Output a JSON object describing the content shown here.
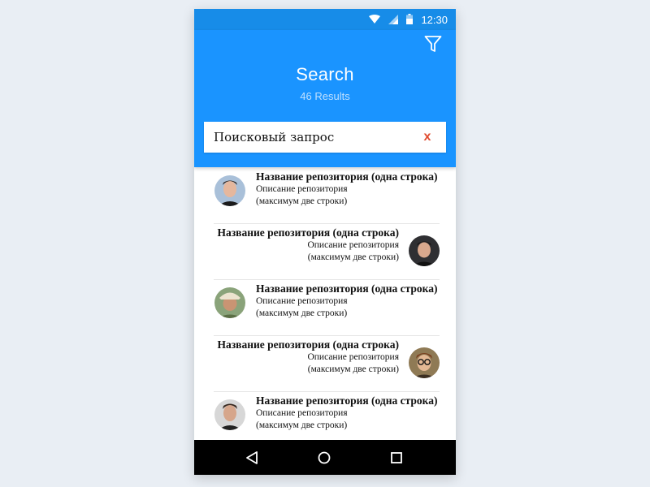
{
  "status_bar": {
    "time": "12:30",
    "icons": [
      "wifi-icon",
      "signal-icon",
      "battery-icon"
    ]
  },
  "header": {
    "title": "Search",
    "subtitle": "46 Results",
    "filter_icon": "filter-icon"
  },
  "search": {
    "value": "Поисковый запрос",
    "clear_label": "x"
  },
  "results": [
    {
      "title": "Название репозитория (одна строка)",
      "desc_line1": "Описание репозитория",
      "desc_line2": "(максимум две строки)",
      "avatar_side": "left"
    },
    {
      "title": "Название репозитория (одна строка)",
      "desc_line1": "Описание репозитория",
      "desc_line2": "(максимум две строки)",
      "avatar_side": "right"
    },
    {
      "title": "Название репозитория (одна строка)",
      "desc_line1": "Описание репозитория",
      "desc_line2": "(максимум две строки)",
      "avatar_side": "left"
    },
    {
      "title": "Название репозитория (одна строка)",
      "desc_line1": "Описание репозитория",
      "desc_line2": "(максимум две строки)",
      "avatar_side": "right"
    },
    {
      "title": "Название репозитория (одна строка)",
      "desc_line1": "Описание репозитория",
      "desc_line2": "(максимум две строки)",
      "avatar_side": "left"
    }
  ],
  "nav": {
    "icons": [
      "back-triangle-icon",
      "home-circle-icon",
      "recents-square-icon"
    ]
  },
  "colors": {
    "header": "#1a94ff",
    "status_bar": "#178ce8",
    "clear": "#e04b2f",
    "background": "#e9eef4"
  }
}
